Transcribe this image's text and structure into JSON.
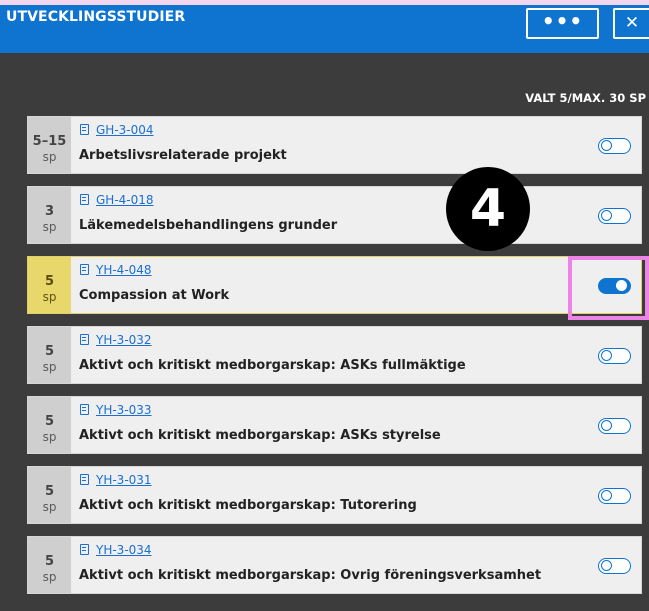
{
  "header": {
    "title": "UTVECKLINGSSTUDIER",
    "more_label": "•••",
    "close_label": "✕"
  },
  "counter": "VALT 5/MAX. 30 SP",
  "annotation": {
    "step": "4"
  },
  "courses": [
    {
      "credits": "5–15",
      "unit": "sp",
      "code": "GH-3-004",
      "name": "Arbetslivsrelaterade projekt",
      "selected": false
    },
    {
      "credits": "3",
      "unit": "sp",
      "code": "GH-4-018",
      "name": "Läkemedelsbehandlingens grunder",
      "selected": false
    },
    {
      "credits": "5",
      "unit": "sp",
      "code": "YH-4-048",
      "name": "Compassion at Work",
      "selected": true
    },
    {
      "credits": "5",
      "unit": "sp",
      "code": "YH-3-032",
      "name": "Aktivt och kritiskt medborgarskap: ASKs fullmäktige",
      "selected": false
    },
    {
      "credits": "5",
      "unit": "sp",
      "code": "YH-3-033",
      "name": "Aktivt och kritiskt medborgarskap: ASKs styrelse",
      "selected": false
    },
    {
      "credits": "5",
      "unit": "sp",
      "code": "YH-3-031",
      "name": "Aktivt och kritiskt medborgarskap: Tutorering",
      "selected": false
    },
    {
      "credits": "5",
      "unit": "sp",
      "code": "YH-3-034",
      "name": "Aktivt och kritiskt medborgarskap: Ovrig föreningsverksamhet",
      "selected": false
    }
  ],
  "colors": {
    "header": "#0e74cf",
    "panel": "#3c3c3c",
    "selected_credit": "#e8d76a",
    "highlight": "#ee83e6"
  }
}
